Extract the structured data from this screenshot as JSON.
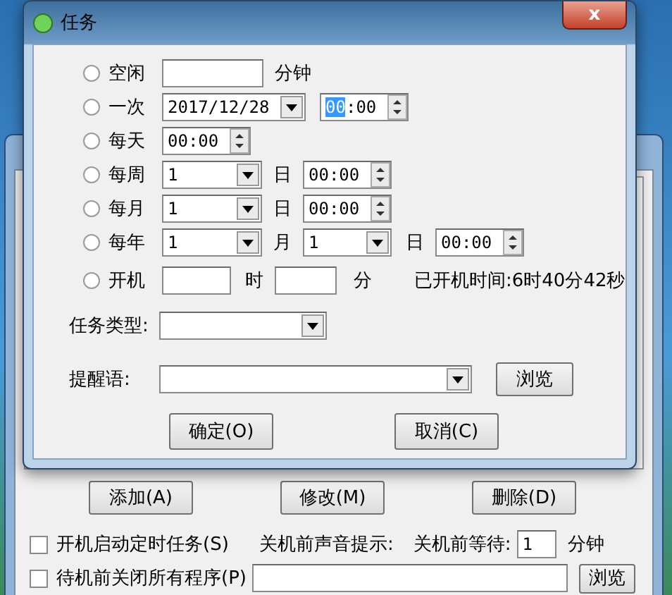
{
  "background_window": {
    "actions": [
      "添加(A)",
      "修改(M)",
      "删除(D)"
    ],
    "options": [
      {
        "label": "开机启动定时任务(S)",
        "checked": false
      },
      {
        "label": "待机前关闭所有程序(P)",
        "checked": false
      }
    ],
    "sound_label": "关机前声音提示:",
    "wait_label": "关机前等待:",
    "wait_value": "1",
    "wait_unit": "分钟",
    "browse": "浏览"
  },
  "dialog": {
    "title": "任务",
    "close": "x",
    "schedule": [
      {
        "kind": "idle",
        "label": "空闲",
        "selected": false,
        "unit": "分钟"
      },
      {
        "kind": "once",
        "label": "一次",
        "selected": false,
        "date": "2017/12/28",
        "hour": "00",
        "separator": ":",
        "minute": "00",
        "hour_selected": true
      },
      {
        "kind": "daily",
        "label": "每天",
        "selected": false,
        "time": "00:00"
      },
      {
        "kind": "weekly",
        "label": "每周",
        "selected": false,
        "day": "1",
        "day_unit": "日",
        "time": "00:00"
      },
      {
        "kind": "monthly",
        "label": "每月",
        "selected": false,
        "day": "1",
        "day_unit": "日",
        "time": "00:00"
      },
      {
        "kind": "yearly",
        "label": "每年",
        "selected": false,
        "month": "1",
        "month_unit": "月",
        "day": "1",
        "day_unit": "日",
        "time": "00:00"
      },
      {
        "kind": "boot",
        "label": "开机",
        "selected": false,
        "hour_unit": "时",
        "minute_unit": "分",
        "uptime": "已开机时间:6时40分42秒"
      }
    ],
    "task_type_label": "任务类型:",
    "reminder_label": "提醒语:",
    "browse": "浏览",
    "buttons": [
      "确定(O)",
      "取消(C)"
    ]
  }
}
